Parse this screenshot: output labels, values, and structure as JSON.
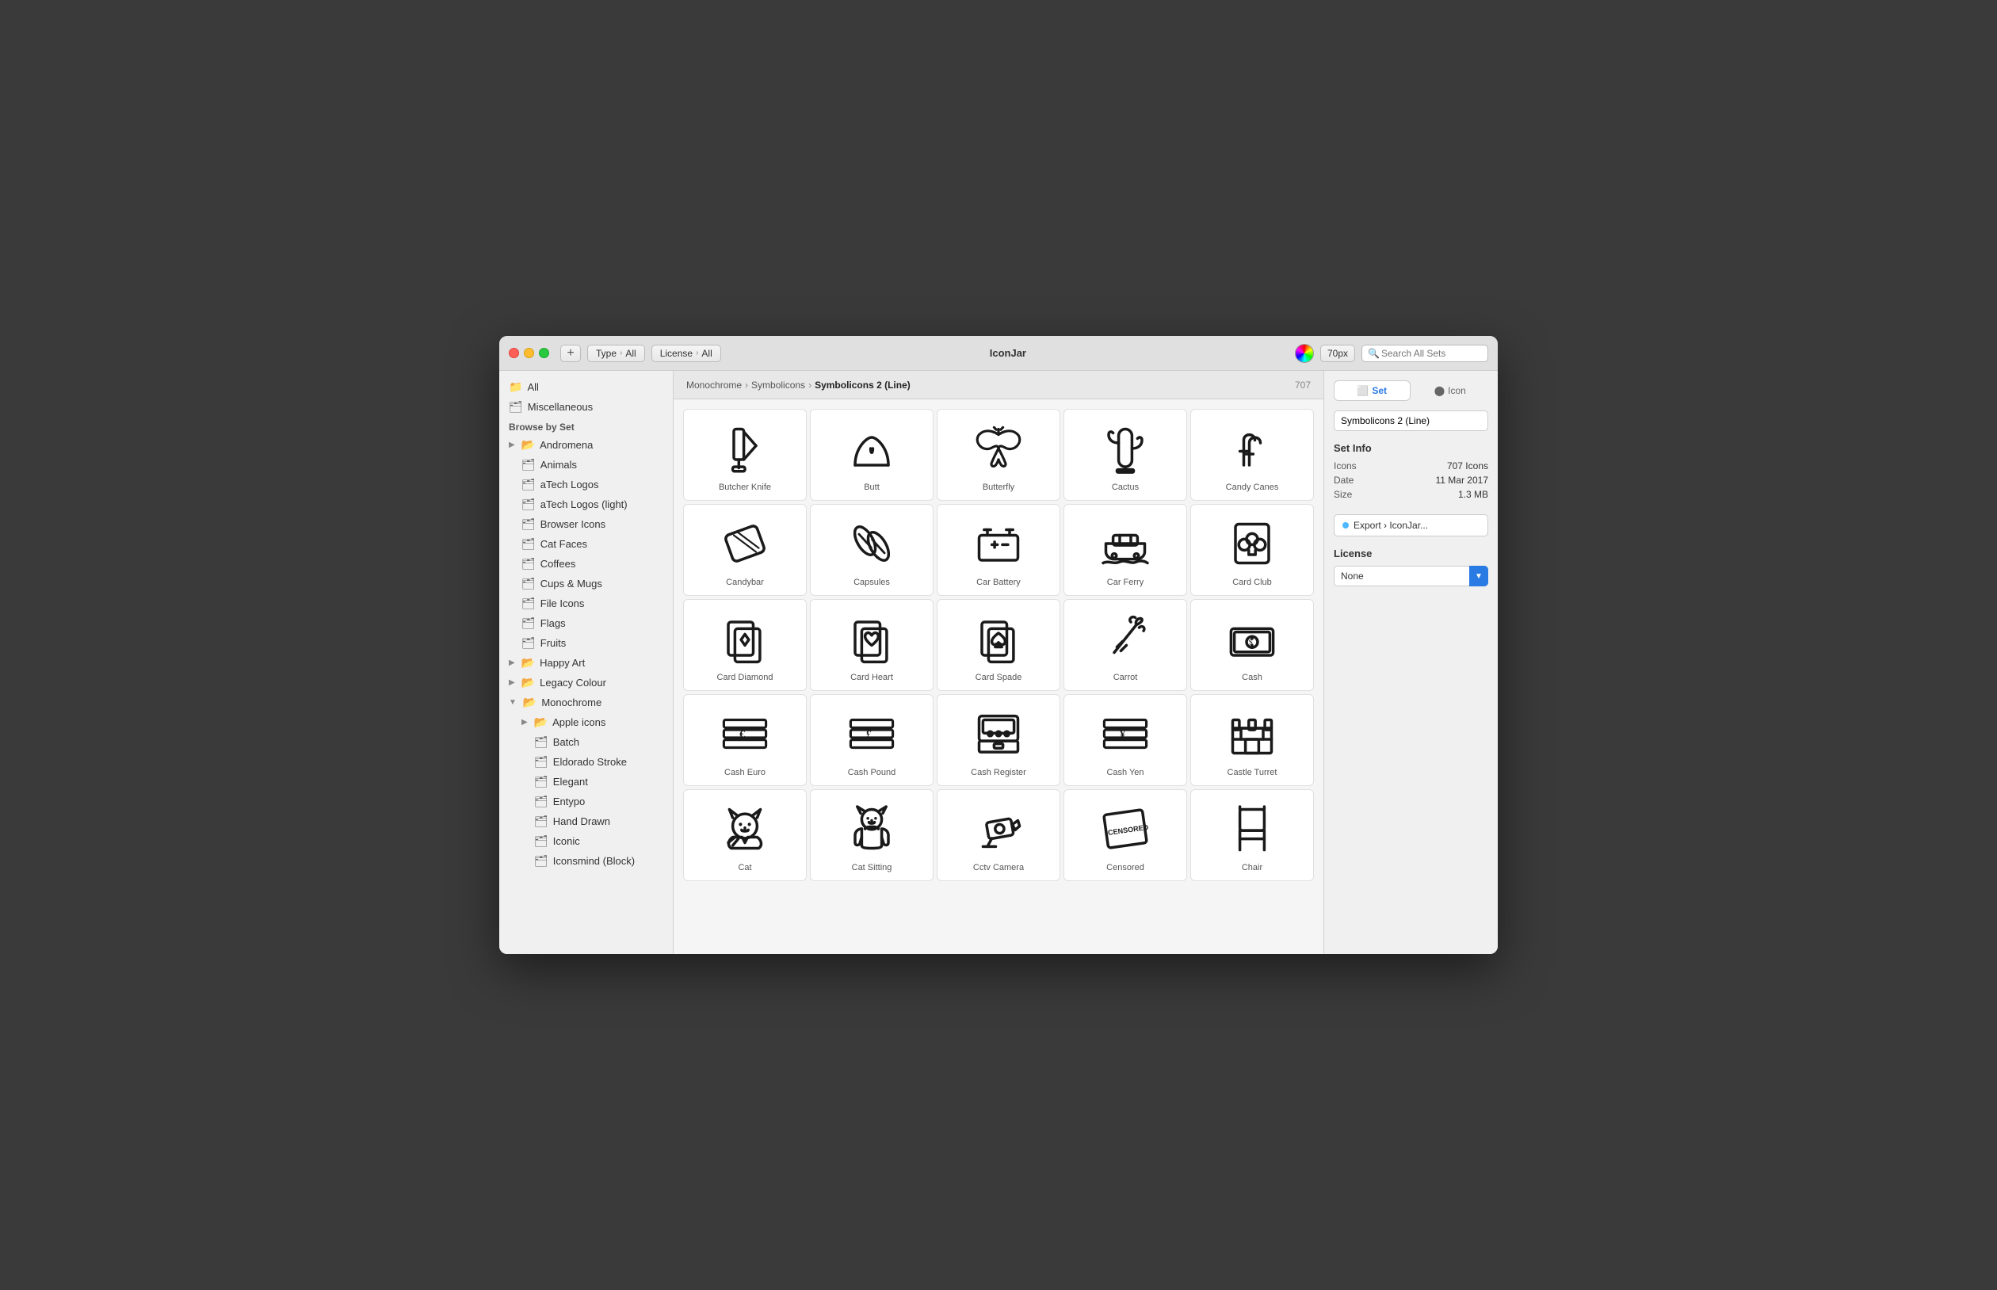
{
  "window": {
    "title": "IconJar"
  },
  "toolbar": {
    "type_label": "Type",
    "type_value": "All",
    "license_label": "License",
    "license_value": "All",
    "add_button": "+",
    "px_label": "70px",
    "search_placeholder": "Search All Sets"
  },
  "breadcrumb": {
    "part1": "Monochrome",
    "part2": "Symbolicons",
    "current": "Symbolicons 2 (Line)",
    "count": "707"
  },
  "sidebar": {
    "browse_label": "Browse by Set",
    "items": [
      {
        "label": "All",
        "indent": 0,
        "type": "folder"
      },
      {
        "label": "Miscellaneous",
        "indent": 0,
        "type": "folder"
      },
      {
        "label": "Andromena",
        "indent": 0,
        "type": "folder-group",
        "collapsed": false
      },
      {
        "label": "Animals",
        "indent": 1,
        "type": "folder"
      },
      {
        "label": "aTech Logos",
        "indent": 1,
        "type": "folder"
      },
      {
        "label": "aTech Logos (light)",
        "indent": 1,
        "type": "folder"
      },
      {
        "label": "Browser Icons",
        "indent": 1,
        "type": "folder"
      },
      {
        "label": "Cat Faces",
        "indent": 1,
        "type": "folder"
      },
      {
        "label": "Coffees",
        "indent": 1,
        "type": "folder"
      },
      {
        "label": "Cups & Mugs",
        "indent": 1,
        "type": "folder"
      },
      {
        "label": "File Icons",
        "indent": 1,
        "type": "folder"
      },
      {
        "label": "Flags",
        "indent": 1,
        "type": "folder"
      },
      {
        "label": "Fruits",
        "indent": 1,
        "type": "folder"
      },
      {
        "label": "Happy Art",
        "indent": 0,
        "type": "folder-group"
      },
      {
        "label": "Legacy Colour",
        "indent": 0,
        "type": "folder-group"
      },
      {
        "label": "Monochrome",
        "indent": 0,
        "type": "folder-group",
        "expanded": true
      },
      {
        "label": "Apple icons",
        "indent": 1,
        "type": "folder-group"
      },
      {
        "label": "Batch",
        "indent": 2,
        "type": "folder"
      },
      {
        "label": "Eldorado Stroke",
        "indent": 2,
        "type": "folder"
      },
      {
        "label": "Elegant",
        "indent": 2,
        "type": "folder"
      },
      {
        "label": "Entypo",
        "indent": 2,
        "type": "folder"
      },
      {
        "label": "Hand Drawn",
        "indent": 2,
        "type": "folder"
      },
      {
        "label": "Iconic",
        "indent": 2,
        "type": "folder"
      },
      {
        "label": "Iconsmind (Block)",
        "indent": 2,
        "type": "folder"
      }
    ]
  },
  "icons": [
    {
      "label": "Butcher Knife",
      "svg_id": "butcher-knife"
    },
    {
      "label": "Butt",
      "svg_id": "butt"
    },
    {
      "label": "Butterfly",
      "svg_id": "butterfly"
    },
    {
      "label": "Cactus",
      "svg_id": "cactus"
    },
    {
      "label": "Candy Canes",
      "svg_id": "candy-canes"
    },
    {
      "label": "Candybar",
      "svg_id": "candybar"
    },
    {
      "label": "Capsules",
      "svg_id": "capsules"
    },
    {
      "label": "Car Battery",
      "svg_id": "car-battery"
    },
    {
      "label": "Car Ferry",
      "svg_id": "car-ferry"
    },
    {
      "label": "Card Club",
      "svg_id": "card-club"
    },
    {
      "label": "Card Diamond",
      "svg_id": "card-diamond"
    },
    {
      "label": "Card Heart",
      "svg_id": "card-heart"
    },
    {
      "label": "Card Spade",
      "svg_id": "card-spade"
    },
    {
      "label": "Carrot",
      "svg_id": "carrot"
    },
    {
      "label": "Cash",
      "svg_id": "cash"
    },
    {
      "label": "Cash Euro",
      "svg_id": "cash-euro"
    },
    {
      "label": "Cash Pound",
      "svg_id": "cash-pound"
    },
    {
      "label": "Cash Register",
      "svg_id": "cash-register"
    },
    {
      "label": "Cash Yen",
      "svg_id": "cash-yen"
    },
    {
      "label": "Castle Turret",
      "svg_id": "castle-turret"
    },
    {
      "label": "Cat",
      "svg_id": "cat"
    },
    {
      "label": "Cat Sitting",
      "svg_id": "cat-sitting"
    },
    {
      "label": "Cctv Camera",
      "svg_id": "cctv-camera"
    },
    {
      "label": "Censored",
      "svg_id": "censored"
    },
    {
      "label": "Chair",
      "svg_id": "chair"
    }
  ],
  "right_panel": {
    "tab_set": "Set",
    "tab_icon": "Icon",
    "set_name": "Symbolicons 2 (Line)",
    "set_info_title": "Set Info",
    "info_rows": [
      {
        "label": "Icons",
        "value": "707 Icons"
      },
      {
        "label": "Date",
        "value": "11 Mar 2017"
      },
      {
        "label": "Size",
        "value": "1.3 MB"
      }
    ],
    "export_label": "Export › IconJar...",
    "license_title": "License",
    "license_value": "None"
  }
}
